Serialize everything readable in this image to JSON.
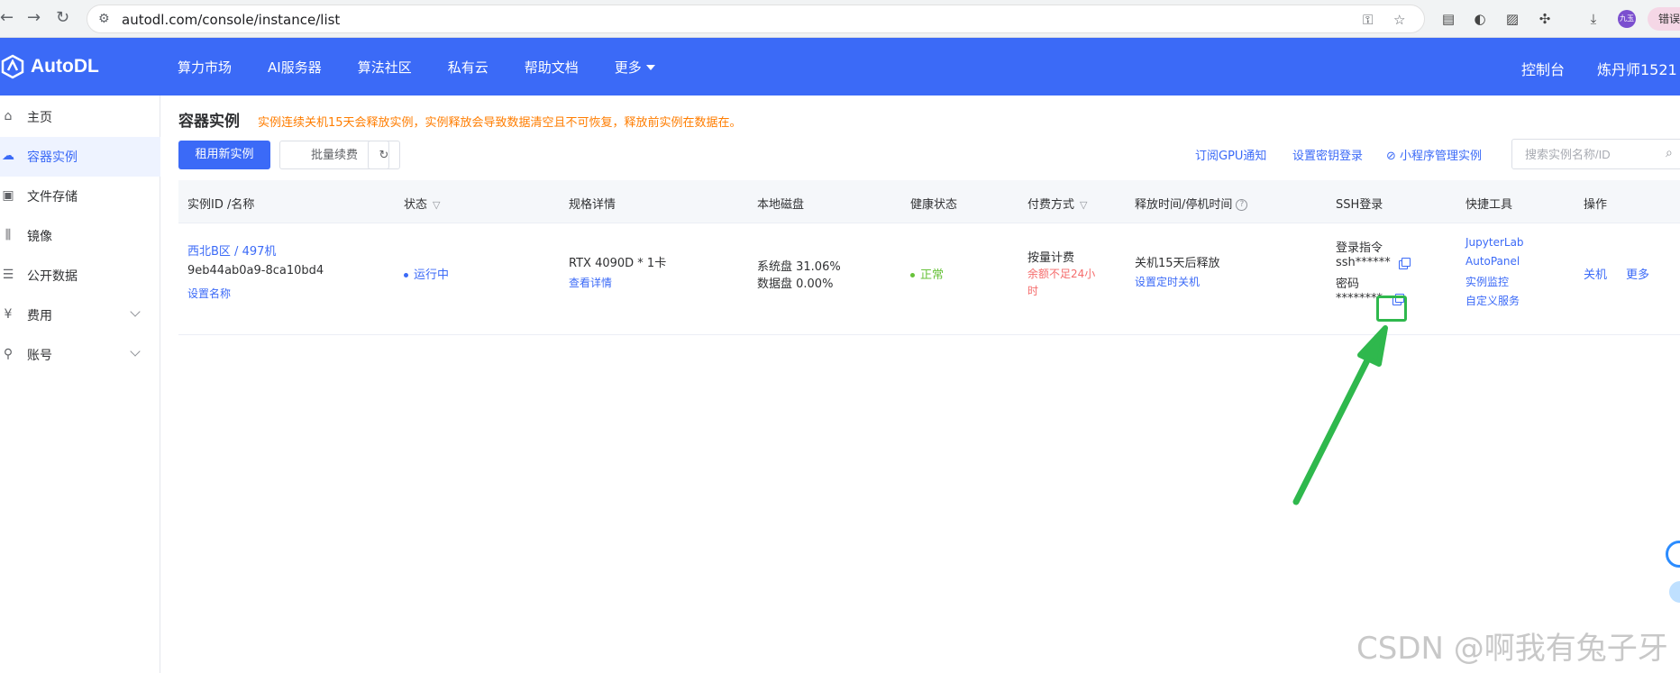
{
  "browser": {
    "url": "autodl.com/console/instance/list",
    "error_button": "错误"
  },
  "header": {
    "logo_text": "AutoDL",
    "nav": [
      "算力市场",
      "AI服务器",
      "算法社区",
      "私有云",
      "帮助文档",
      "更多"
    ],
    "console_label": "控制台",
    "user_label": "炼丹师1521 ·"
  },
  "sidebar": {
    "items": [
      {
        "label": "主页",
        "icon": "home-icon"
      },
      {
        "label": "容器实例",
        "icon": "container-icon"
      },
      {
        "label": "文件存储",
        "icon": "storage-icon"
      },
      {
        "label": "镜像",
        "icon": "image-icon"
      },
      {
        "label": "公开数据",
        "icon": "database-icon"
      },
      {
        "label": "费用",
        "icon": "yuan-icon"
      },
      {
        "label": "账号",
        "icon": "user-icon"
      }
    ],
    "active": "容器实例"
  },
  "main": {
    "title": "容器实例",
    "notice": "实例连续关机15天会释放实例，实例释放会导致数据清空且不可恢复，释放前实例在数据在。",
    "rent_button": "租用新实例",
    "renew_button": "批量续费",
    "links": {
      "gpu_notify": "订阅GPU通知",
      "set_key": "设置密钥登录",
      "miniprogram": "小程序管理实例"
    },
    "search_placeholder": "搜索实例名称/ID"
  },
  "table": {
    "headers": {
      "id_name": "实例ID /名称",
      "status": "状态",
      "spec": "规格详情",
      "disk": "本地磁盘",
      "health": "健康状态",
      "billing": "付费方式",
      "release": "释放时间/停机时间",
      "ssh": "SSH登录",
      "tools": "快捷工具",
      "ops": "操作"
    },
    "row": {
      "region": "西北B区 / 497机",
      "instance_id": "9eb44ab0a9-8ca10bd4",
      "set_name": "设置名称",
      "status": "运行中",
      "spec": "RTX 4090D * 1卡",
      "spec_detail": "查看详情",
      "system_disk": "系统盘 31.06%",
      "data_disk": "数据盘 0.00%",
      "health": "正常",
      "billing": "按量计费",
      "billing_warn_1": "余额不足24小",
      "billing_warn_2": "时",
      "release": "关机15天后释放",
      "set_timer": "设置定时关机",
      "login_cmd_label": "登录指令",
      "login_cmd_value": "ssh******",
      "password_label": "密码",
      "password_value": "********",
      "tools": [
        "JupyterLab",
        "AutoPanel",
        "实例监控",
        "自定义服务"
      ],
      "op_shutdown": "关机",
      "op_more": "更多"
    }
  },
  "colors": {
    "brand": "#3b6af7",
    "warning": "#ff7d00",
    "highlight": "#2fb84d"
  },
  "watermark": "CSDN @啊我有兔子牙"
}
